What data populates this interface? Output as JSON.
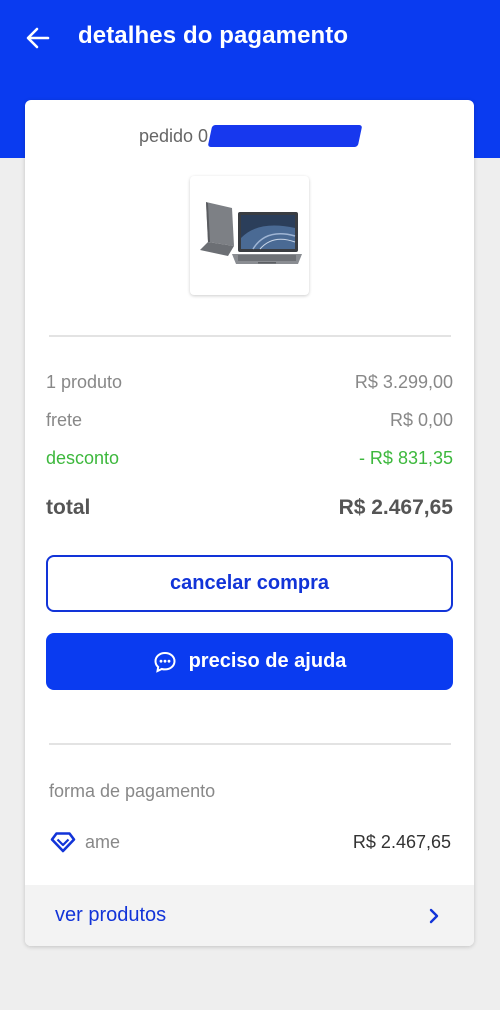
{
  "header": {
    "title": "detalhes do pagamento",
    "back_icon": "arrow-left-icon",
    "background": "#0a3bf0"
  },
  "order": {
    "label": "pedido 0"
  },
  "summary": {
    "items": [
      {
        "label": "1 produto",
        "value": "R$ 3.299,00"
      },
      {
        "label": "frete",
        "value": "R$ 0,00"
      },
      {
        "label": "desconto",
        "value": "- R$ 831,35"
      }
    ],
    "total": {
      "label": "total",
      "value": "R$ 2.467,65"
    }
  },
  "actions": {
    "cancel_label": "cancelar compra",
    "help_label": "preciso de ajuda",
    "help_icon": "chat-bubble-icon"
  },
  "payment": {
    "section_label": "forma de pagamento",
    "method": "ame",
    "method_icon": "ame-heart-icon",
    "amount": "R$ 2.467,65"
  },
  "footer": {
    "link_label": "ver produtos",
    "chevron_icon": "chevron-right-icon"
  },
  "colors": {
    "brand_blue": "#0a3bf0",
    "discount_green": "#3db83d",
    "link_blue": "#1234d8"
  }
}
